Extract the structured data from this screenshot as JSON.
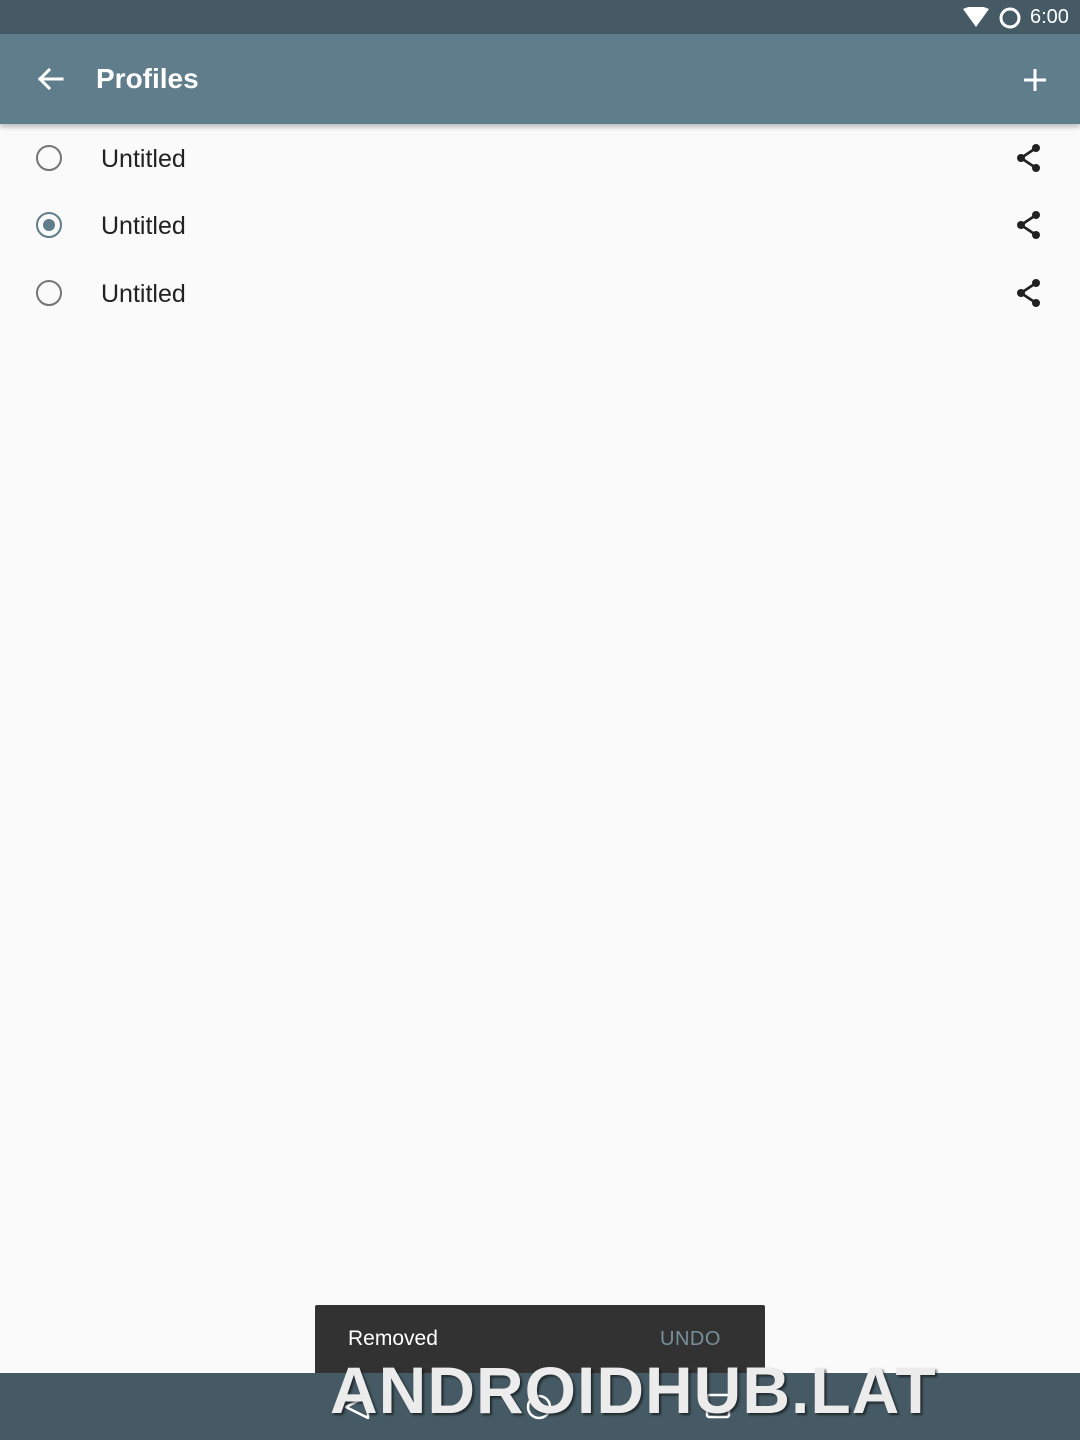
{
  "status_bar": {
    "time": "6:00",
    "icons": [
      "wifi-icon",
      "ring-icon"
    ]
  },
  "toolbar": {
    "title": "Profiles",
    "back_icon": "arrow-back-icon",
    "add_icon": "plus-icon",
    "color": "#607d8b"
  },
  "profiles": [
    {
      "name": "Untitled",
      "selected": false
    },
    {
      "name": "Untitled",
      "selected": true
    },
    {
      "name": "Untitled",
      "selected": false
    }
  ],
  "snackbar": {
    "message": "Removed",
    "action": "UNDO"
  },
  "nav_bar": {
    "icons": [
      "nav-back-icon",
      "nav-home-icon",
      "nav-recents-icon"
    ],
    "color": "#455a64"
  },
  "watermark": "ANDROIDHUB.LAT",
  "colors": {
    "accent": "#607d8b",
    "status_bar": "#455a64",
    "background": "#fafafa"
  }
}
